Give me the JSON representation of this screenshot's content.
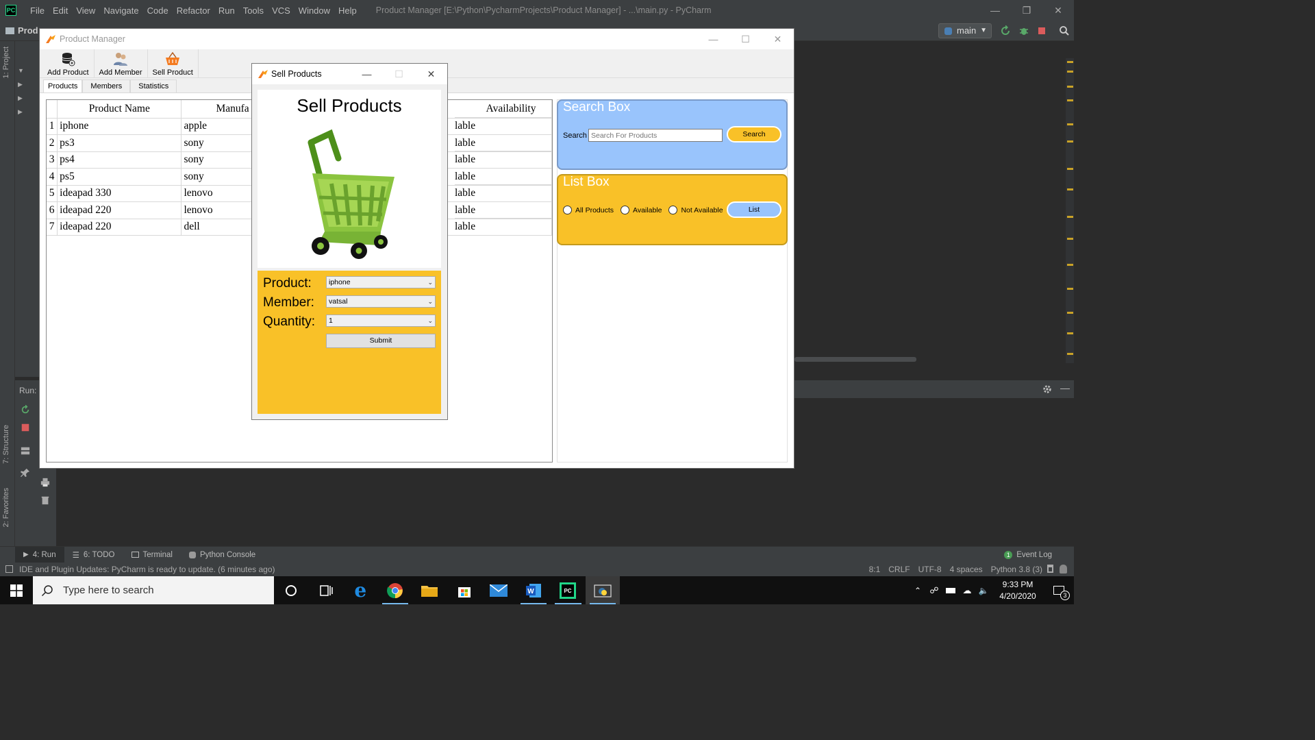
{
  "ide": {
    "menu": [
      "File",
      "Edit",
      "View",
      "Navigate",
      "Code",
      "Refactor",
      "Run",
      "Tools",
      "VCS",
      "Window",
      "Help"
    ],
    "title": "Product Manager [E:\\Python\\PycharmProjects\\Product Manager] - ...\\main.py - PyCharm",
    "crumb": "Prod",
    "run_config": "main",
    "side_labels": {
      "project": "1: Project",
      "structure": "7: Structure",
      "favorites": "2: Favorites"
    },
    "run_label": "Run:",
    "bottom_tabs": [
      {
        "label": "4: Run",
        "icon": "play-icon"
      },
      {
        "label": "6: TODO",
        "icon": "list-icon"
      },
      {
        "label": "Terminal",
        "icon": "terminal-icon"
      },
      {
        "label": "Python Console",
        "icon": "python-icon"
      }
    ],
    "event_log": "Event Log",
    "event_count": "1",
    "status_message": "IDE and Plugin Updates: PyCharm is ready to update. (6 minutes ago)",
    "status_right": [
      "8:1",
      "CRLF",
      "UTF-8",
      "4 spaces",
      "Python 3.8 (3)"
    ]
  },
  "taskbar": {
    "search_placeholder": "Type here to search",
    "time": "9:33 PM",
    "date": "4/20/2020",
    "notifications": "3"
  },
  "app": {
    "title": "Product Manager",
    "toolbar": [
      {
        "label": "Add Product",
        "icon": "database-icon"
      },
      {
        "label": "Add Member",
        "icon": "users-icon"
      },
      {
        "label": "Sell Product",
        "icon": "basket-icon"
      }
    ],
    "tabs": [
      "Products",
      "Members",
      "Statistics"
    ],
    "active_tab": "Products",
    "table": {
      "headers": [
        "Product Name",
        "Manufa",
        "Availability"
      ],
      "rows": [
        {
          "n": "1",
          "name": "iphone",
          "manu": "apple",
          "avail": "lable"
        },
        {
          "n": "2",
          "name": "ps3",
          "manu": "sony",
          "avail": "lable"
        },
        {
          "n": "3",
          "name": "ps4",
          "manu": "sony",
          "avail": "lable"
        },
        {
          "n": "4",
          "name": "ps5",
          "manu": "sony",
          "avail": "lable"
        },
        {
          "n": "5",
          "name": "ideapad 330",
          "manu": "lenovo",
          "avail": "lable"
        },
        {
          "n": "6",
          "name": "ideapad 220",
          "manu": "lenovo",
          "avail": "lable"
        },
        {
          "n": "7",
          "name": "ideapad 220",
          "manu": "dell",
          "avail": "lable"
        }
      ]
    },
    "search_box": {
      "title": "Search Box",
      "label": "Search",
      "placeholder": "Search For Products",
      "button": "Search"
    },
    "list_box": {
      "title": "List Box",
      "options": [
        "All Products",
        "Available",
        "Not Available"
      ],
      "button": "List"
    }
  },
  "dialog": {
    "title": "Sell Products",
    "heading": "Sell Products",
    "labels": {
      "product": "Product:",
      "member": "Member:",
      "quantity": "Quantity:"
    },
    "values": {
      "product": "iphone",
      "member": "vatsal",
      "quantity": "1"
    },
    "submit": "Submit"
  },
  "colors": {
    "yellow": "#f9c128",
    "blue": "#99c4fc",
    "ide_bg": "#2b2b2b",
    "ide_panel": "#3c3f41"
  }
}
